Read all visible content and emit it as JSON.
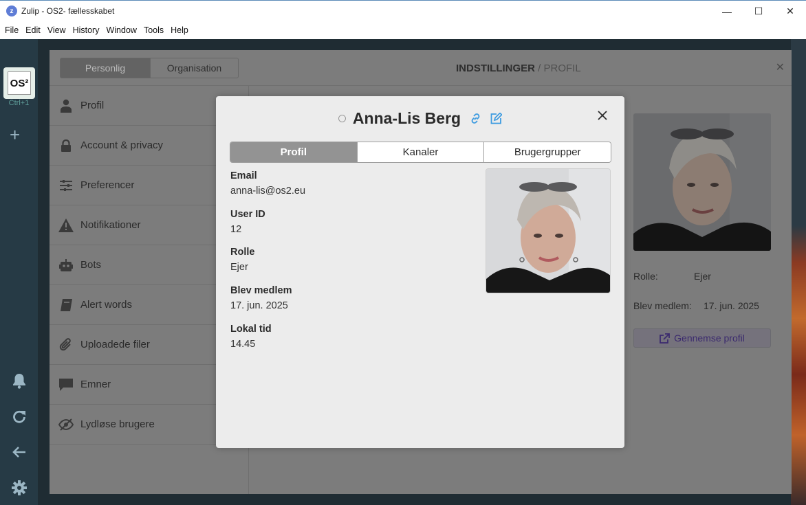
{
  "window": {
    "title": "Zulip - OS2- fællesskabet",
    "controls": {
      "minimize": "—",
      "maximize": "☐",
      "close": "✕"
    }
  },
  "menubar": [
    "File",
    "Edit",
    "View",
    "History",
    "Window",
    "Tools",
    "Help"
  ],
  "leftstrip": {
    "org_logo_text": "OS²",
    "shortcut": "Ctrl+1",
    "add_label": "+"
  },
  "settings": {
    "tabs": {
      "personal": "Personlig",
      "organization": "Organisation"
    },
    "heading_main": "INDSTILLINGER",
    "heading_sep": " / ",
    "heading_sub": "PROFIL",
    "nav": [
      {
        "label": "Profil",
        "icon": "user-icon"
      },
      {
        "label": "Account & privacy",
        "icon": "lock-icon"
      },
      {
        "label": "Preferencer",
        "icon": "sliders-icon"
      },
      {
        "label": "Notifikationer",
        "icon": "warning-icon"
      },
      {
        "label": "Bots",
        "icon": "robot-icon"
      },
      {
        "label": "Alert words",
        "icon": "book-icon"
      },
      {
        "label": "Uploadede filer",
        "icon": "paperclip-icon"
      },
      {
        "label": "Emner",
        "icon": "message-icon"
      },
      {
        "label": "Lydløse brugere",
        "icon": "eye-slash-icon"
      }
    ],
    "preview": {
      "role_label": "Rolle:",
      "role_value": "Ejer",
      "joined_label": "Blev medlem:",
      "joined_value": "17. jun. 2025",
      "view_profile": "Gennemse profil"
    }
  },
  "modal": {
    "name": "Anna-Lis Berg",
    "tabs": [
      "Profil",
      "Kanaler",
      "Brugergrupper"
    ],
    "active_tab": "Profil",
    "fields": [
      {
        "label": "Email",
        "value": "anna-lis@os2.eu"
      },
      {
        "label": "User ID",
        "value": "12"
      },
      {
        "label": "Rolle",
        "value": "Ejer"
      },
      {
        "label": "Blev medlem",
        "value": "17. jun. 2025"
      },
      {
        "label": "Lokal tid",
        "value": "14.45"
      }
    ]
  },
  "colors": {
    "link_icon": "#3d9be0",
    "modal_bg": "#ececec",
    "active_tab": "#939393",
    "left_strip": "#263a45"
  }
}
